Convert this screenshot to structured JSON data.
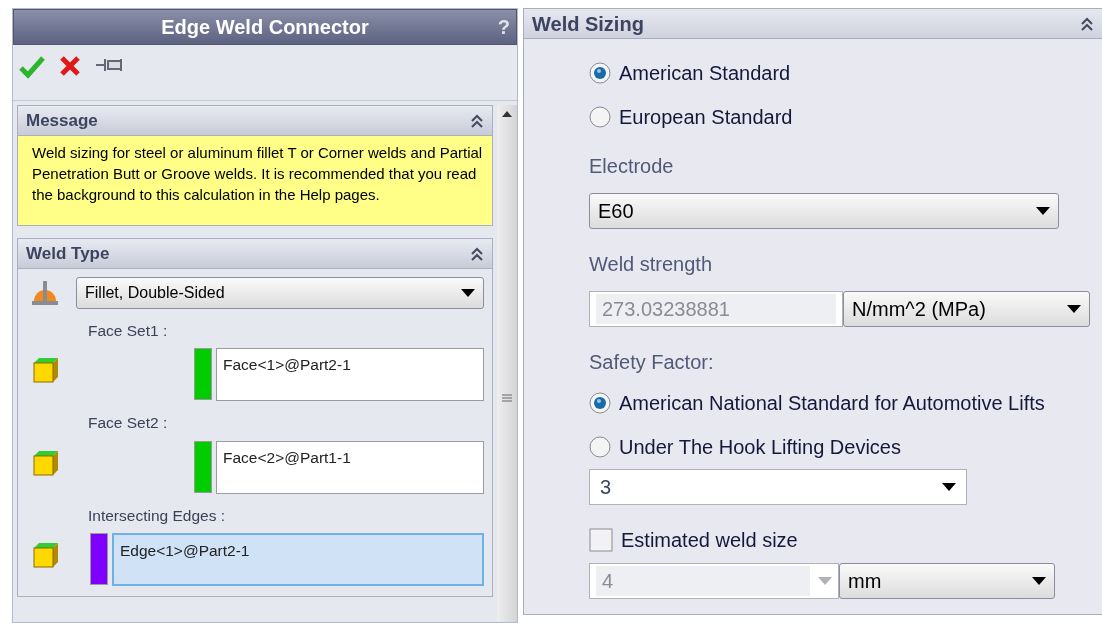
{
  "property_manager": {
    "title": "Edge Weld Connector",
    "help": "?",
    "message": {
      "title": "Message",
      "expanded": true,
      "text": "Weld sizing for steel or aluminum fillet T or Corner welds and Partial Penetration Butt or Groove welds. It is recommended that you read the background to this calculation in the Help pages."
    },
    "weld_type": {
      "title": "Weld Type",
      "expanded": true,
      "type_value": "Fillet, Double-Sided",
      "selections": [
        {
          "kind": "faces",
          "label": "Face Set1 :",
          "value": "Face<1>@Part2-1",
          "color": "#00cc00",
          "selected": false
        },
        {
          "kind": "faces",
          "label": "Face Set2 :",
          "value": "Face<2>@Part1-1",
          "color": "#00cc00",
          "selected": false
        },
        {
          "kind": "edges",
          "label": "Intersecting Edges :",
          "value": "Edge<1>@Part2-1",
          "color": "#7f00ff",
          "selected": true
        }
      ]
    }
  },
  "weld_sizing": {
    "title": "Weld Sizing",
    "expanded": true,
    "standards": [
      {
        "label": "American Standard",
        "selected": true
      },
      {
        "label": "European Standard",
        "selected": false
      }
    ],
    "electrode_label": "Electrode",
    "electrode": "E60",
    "strength_label": "Weld strength",
    "strength": "273.03238881",
    "strength_unit": "N/mm^2 (MPa)",
    "safety_label": "Safety Factor:",
    "safety_options": [
      {
        "label": "American National Standard for Automotive Lifts",
        "selected": true
      },
      {
        "label": "Under The Hook Lifting Devices",
        "selected": false
      }
    ],
    "safety_factor": "3",
    "estimate": {
      "label": "Estimated weld size",
      "checked": false
    },
    "weld_size": "4",
    "weld_size_disabled": true,
    "weld_size_unit": "mm"
  }
}
